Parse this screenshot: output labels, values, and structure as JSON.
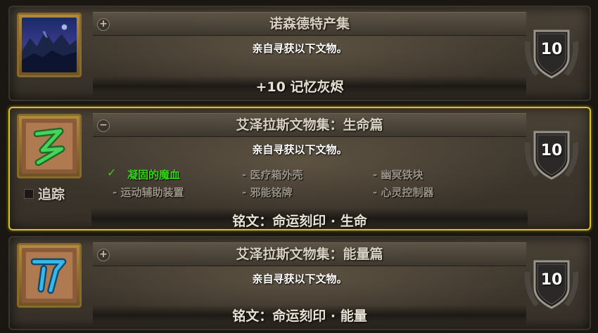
{
  "colors": {
    "selected_border": "#d8c21e",
    "completed_green": "#34d319",
    "pending_grey": "#9a9387"
  },
  "cards": [
    {
      "title": "诺森德特产集",
      "description": "亲自寻获以下文物。",
      "reward": "+10 记忆灰烬",
      "points": "10",
      "toggle": "+",
      "icon": "northrend-landscape-icon"
    },
    {
      "title": "艾泽拉斯文物集：生命篇",
      "description": "亲自寻获以下文物。",
      "reward": "铭文：命运刻印 · 生命",
      "points": "10",
      "toggle": "−",
      "icon": "green-rune-icon",
      "selected": true,
      "track_label": "追踪",
      "criteria": [
        {
          "label": "凝固的魔血",
          "done": true
        },
        {
          "label": "- 医疗箱外壳",
          "done": false
        },
        {
          "label": "- 幽冥铁块",
          "done": false
        },
        {
          "label": "- 运动辅助装置",
          "done": false
        },
        {
          "label": "- 邪能铭牌",
          "done": false
        },
        {
          "label": "- 心灵控制器",
          "done": false
        }
      ]
    },
    {
      "title": "艾泽拉斯文物集：能量篇",
      "description": "亲自寻获以下文物。",
      "reward": "铭文：命运刻印 · 能量",
      "points": "10",
      "toggle": "+",
      "icon": "blue-rune-icon"
    }
  ]
}
